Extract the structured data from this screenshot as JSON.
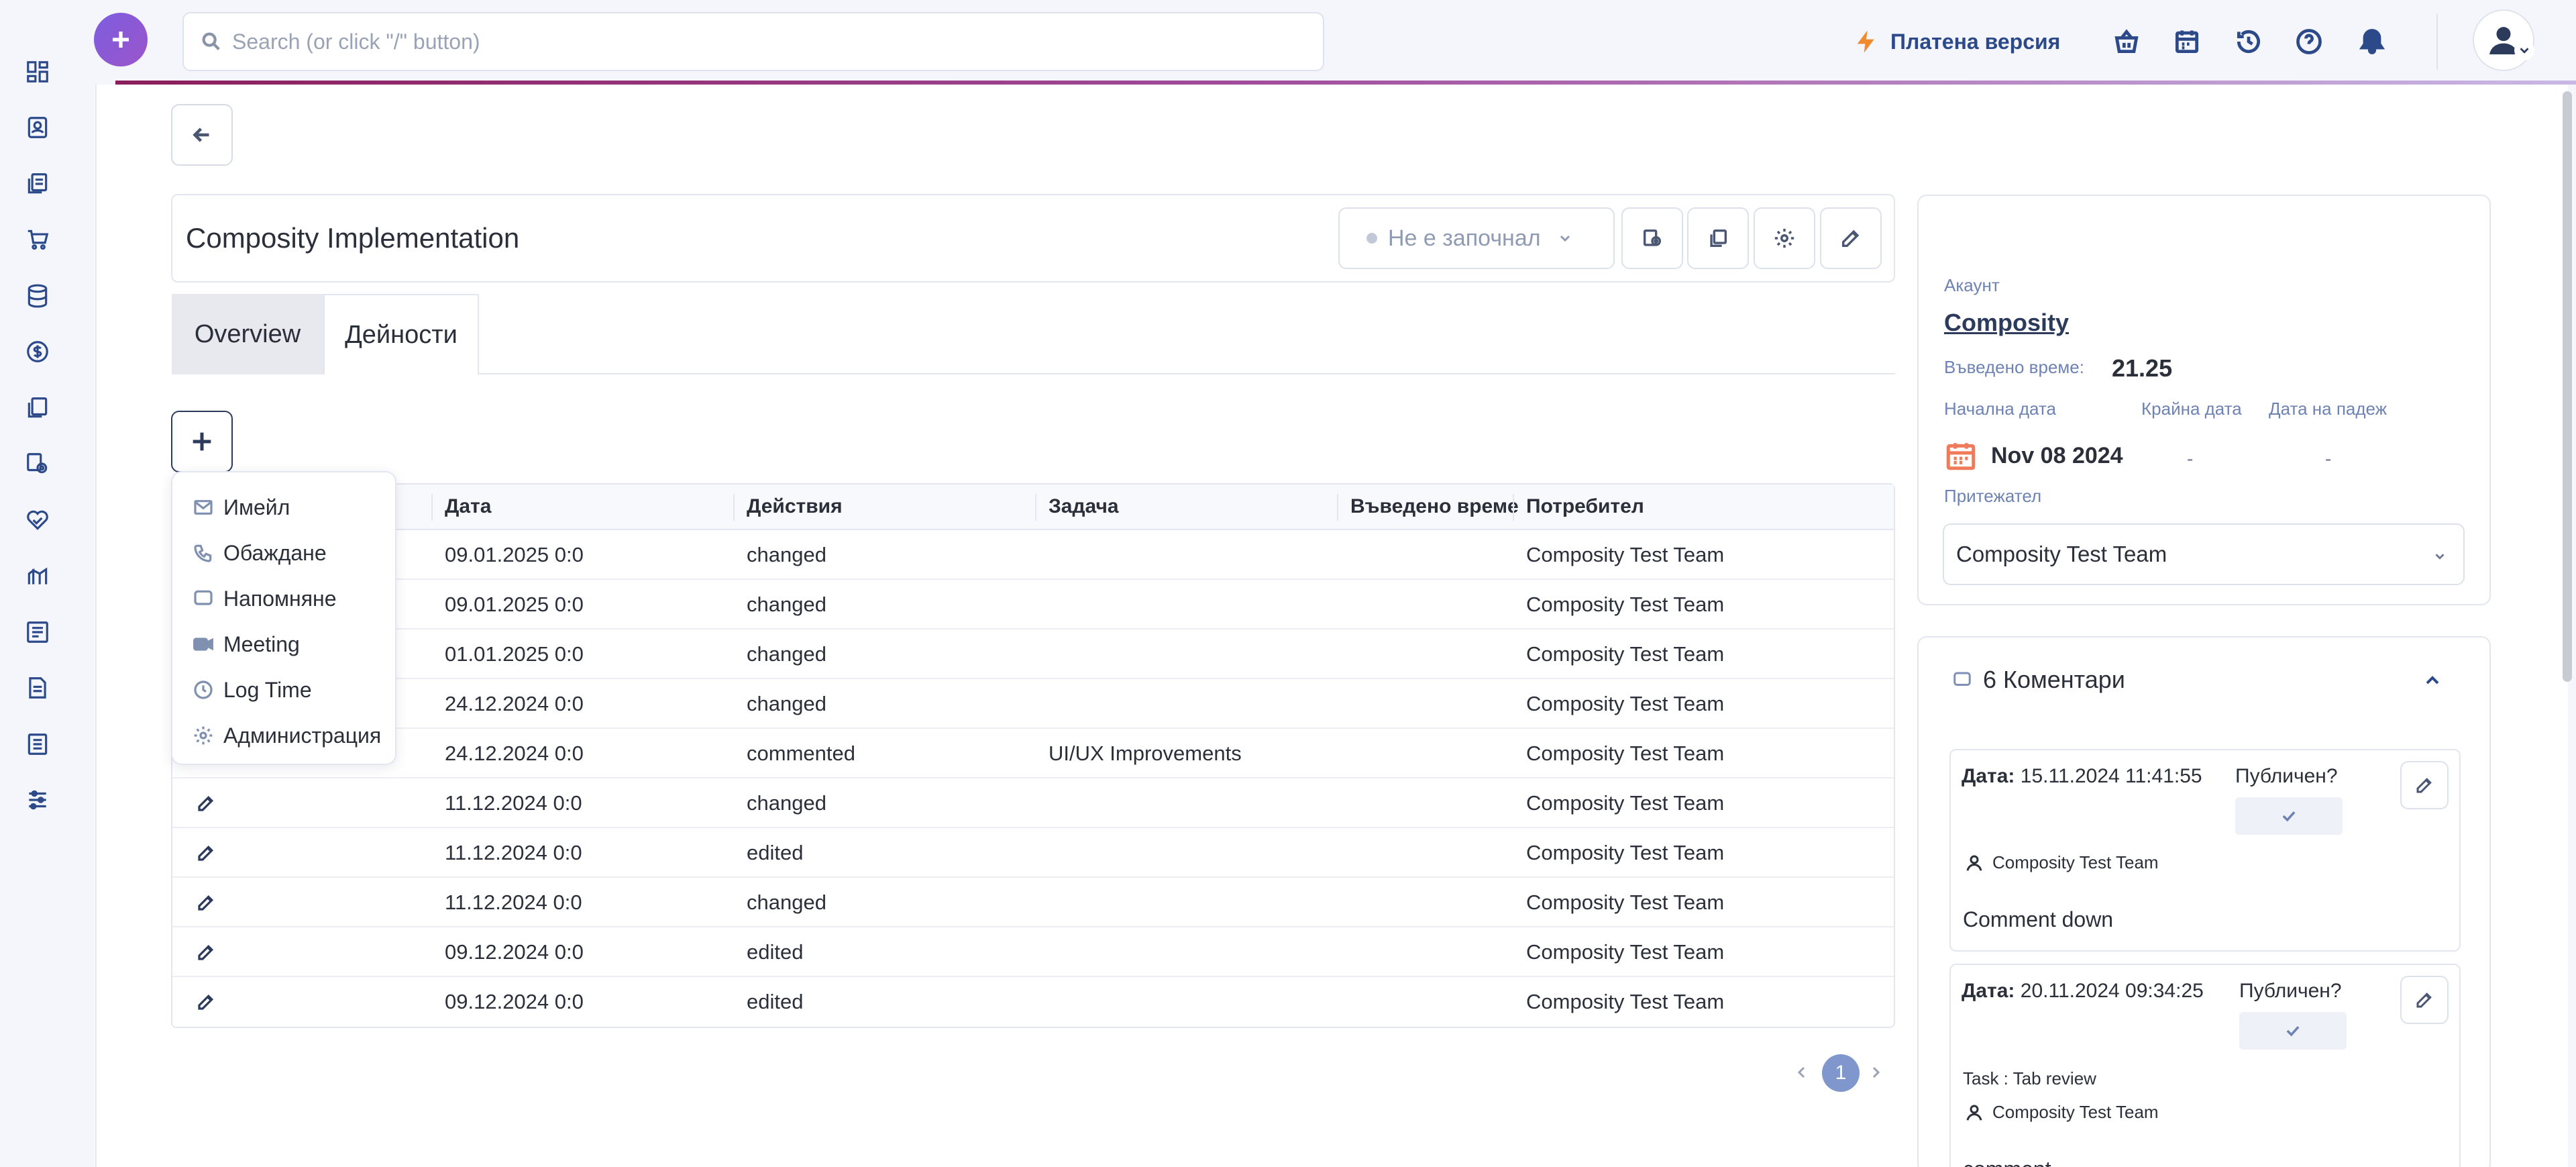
{
  "search": {
    "placeholder": "Search (or click \"/\" button)"
  },
  "header": {
    "paid_version": "Платена версия",
    "accent_color": "#f08a2d",
    "icons": [
      "basket-icon",
      "calendar-icon",
      "history-icon",
      "help-icon",
      "bell-icon"
    ]
  },
  "sidebar": {
    "icons": [
      "dashboard-icon",
      "contacts-icon",
      "documents-icon",
      "cart-icon",
      "database-icon",
      "finance-icon",
      "files-icon",
      "settings-gear-icon",
      "handshake-icon",
      "chart-icon",
      "reports-icon",
      "invoice-icon",
      "records-icon",
      "sliders-icon"
    ]
  },
  "project": {
    "title": "Composity Implementation",
    "status": "Не е започнал"
  },
  "tabs": [
    "Overview",
    "Дейности"
  ],
  "add_menu": [
    "Имейл",
    "Обаждане",
    "Напомняне",
    "Meeting",
    "Log Time",
    "Администрация"
  ],
  "table": {
    "headers": [
      "Дата",
      "Действия",
      "Задача",
      "Въведено време",
      "Потребител"
    ],
    "rows": [
      {
        "date": "09.01.2025 0:0",
        "action": "changed",
        "task": "",
        "time": "",
        "user": "Composity Test Team"
      },
      {
        "date": "09.01.2025 0:0",
        "action": "changed",
        "task": "",
        "time": "",
        "user": "Composity Test Team"
      },
      {
        "date": "01.01.2025 0:0",
        "action": "changed",
        "task": "",
        "time": "",
        "user": "Composity Test Team"
      },
      {
        "date": "24.12.2024 0:0",
        "action": "changed",
        "task": "",
        "time": "",
        "user": "Composity Test Team"
      },
      {
        "date": "24.12.2024 0:0",
        "action": "commented",
        "task": "UI/UX Improvements",
        "time": "",
        "user": "Composity Test Team"
      },
      {
        "date": "11.12.2024 0:0",
        "action": "changed",
        "task": "",
        "time": "",
        "user": "Composity Test Team"
      },
      {
        "date": "11.12.2024 0:0",
        "action": "edited",
        "task": "",
        "time": "",
        "user": "Composity Test Team"
      },
      {
        "date": "11.12.2024 0:0",
        "action": "changed",
        "task": "",
        "time": "",
        "user": "Composity Test Team"
      },
      {
        "date": "09.12.2024 0:0",
        "action": "edited",
        "task": "",
        "time": "",
        "user": "Composity Test Team"
      },
      {
        "date": "09.12.2024 0:0",
        "action": "edited",
        "task": "",
        "time": "",
        "user": "Composity Test Team"
      }
    ]
  },
  "pagination": {
    "current": "1"
  },
  "details": {
    "account_label": "Акаунт",
    "account": "Composity",
    "time_label": "Въведено време:",
    "time_value": "21.25",
    "start_label": "Начална дата",
    "end_label": "Крайна дата",
    "due_label": "Дата на падеж",
    "start_value": "Nov 08 2024",
    "end_value": "-",
    "due_value": "-",
    "owner_label": "Притежател",
    "owner": "Composity Test Team"
  },
  "comments": {
    "header": "6 Коментари",
    "items": [
      {
        "date_label": "Дата:",
        "date": "15.11.2024 11:41:55",
        "published_label": "Публичен?",
        "task": "",
        "user": "Composity Test Team",
        "text": "Comment down"
      },
      {
        "date_label": "Дата:",
        "date": "20.11.2024 09:34:25",
        "published_label": "Публичен?",
        "task": "Task : Tab review",
        "user": "Composity Test Team",
        "text": "comment"
      }
    ]
  }
}
